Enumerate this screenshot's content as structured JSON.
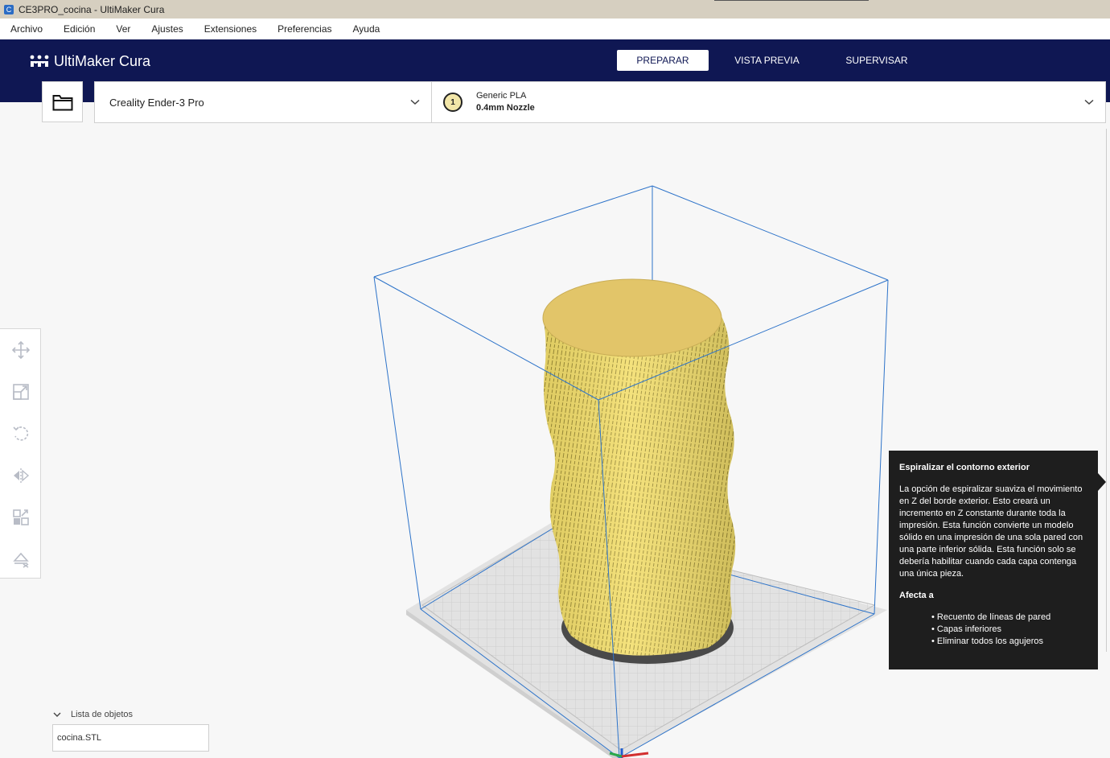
{
  "window": {
    "title": "CE3PRO_cocina - UltiMaker Cura",
    "app_icon": "cura-app-icon"
  },
  "menu": [
    "Archivo",
    "Edición",
    "Ver",
    "Ajustes",
    "Extensiones",
    "Preferencias",
    "Ayuda"
  ],
  "header": {
    "logo_text": "UltiMaker Cura",
    "tabs": [
      {
        "label": "PREPARAR",
        "active": true
      },
      {
        "label": "VISTA PREVIA",
        "active": false
      },
      {
        "label": "SUPERVISAR",
        "active": false
      }
    ],
    "bg_color": "#0f1753"
  },
  "printer": {
    "name": "Creality Ender-3 Pro"
  },
  "extruder": {
    "number": "1",
    "material": "Generic PLA",
    "nozzle": "0.4mm Nozzle"
  },
  "tools": [
    "move-icon",
    "scale-icon",
    "rotate-icon",
    "mirror-icon",
    "per-model-settings-icon",
    "support-blocker-icon"
  ],
  "model": {
    "color": "#f5dc6e"
  },
  "tooltip": {
    "title": "Espiralizar el contorno exterior",
    "description": "La opción de espiralizar suaviza el movimiento en Z del borde exterior. Esto creará un incremento en Z constante durante toda la impresión. Esta función convierte un modelo sólido en una impresión de una sola pared con una parte inferior sólida. Esta función solo se debería habilitar cuando cada capa contenga una única pieza.",
    "affects_label": "Afecta a",
    "affects": [
      "Recuento de líneas de pared",
      "Capas inferiores",
      "Eliminar todos los agujeros"
    ]
  },
  "object_list": {
    "label": "Lista de objetos",
    "item": "cocina.STL"
  }
}
